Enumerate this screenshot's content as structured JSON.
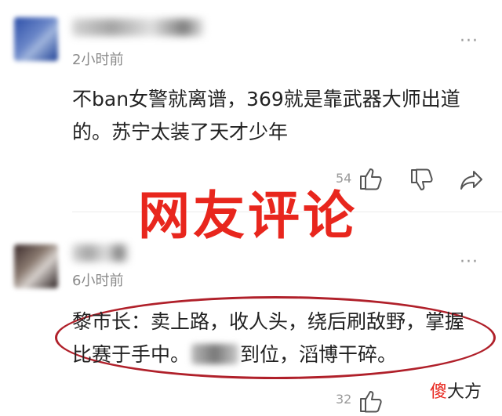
{
  "comment1": {
    "time": "2小时前",
    "more": "···",
    "line1": "不ban女警就离谱，369就是靠武器大师出道",
    "line2": "的。苏宁太装了天才少年",
    "likes": "54"
  },
  "overlay": {
    "title": "网友评论"
  },
  "comment2": {
    "time": "6小时前",
    "more": "···",
    "line1": "黎市长：卖上路，收人头，绕后刷敌野，掌握",
    "line2a": "比赛于手中。",
    "line2b": "到位，滔博干碎。",
    "likes": "32"
  },
  "watermark": {
    "part1": "傻",
    "part2": "大方"
  },
  "colors": {
    "accent_red": "#e8261d",
    "ellipse": "#b0202a"
  },
  "icons": [
    "thumbs-up-icon",
    "thumbs-down-icon",
    "share-icon",
    "more-icon"
  ]
}
